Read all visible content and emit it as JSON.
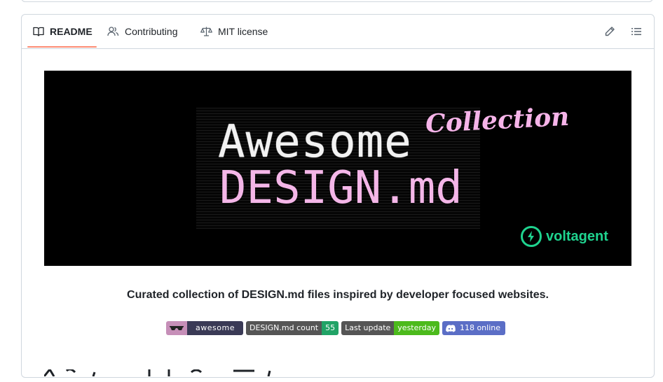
{
  "tabs": [
    {
      "label": "README",
      "icon": "book-icon",
      "active": true
    },
    {
      "label": "Contributing",
      "icon": "people-icon",
      "active": false
    },
    {
      "label": "MIT license",
      "icon": "law-icon",
      "active": false
    }
  ],
  "toolbar": {
    "edit_icon": "pencil-icon",
    "outline_icon": "list-icon"
  },
  "banner": {
    "line1": "Awesome",
    "line2": "DESIGN.md",
    "script": "Collection",
    "brand": "voltagent"
  },
  "tagline": "Curated collection of DESIGN.md files inspired by developer focused websites.",
  "badges": {
    "awesome": {
      "right": "awesome",
      "left_color": "#c68fb8",
      "right_color": "#3a3a56"
    },
    "count": {
      "left": "DESIGN.md count",
      "right": "55",
      "left_color": "#555555",
      "right_color": "#21a366"
    },
    "update": {
      "left": "Last update",
      "right": "yesterday",
      "left_color": "#555555",
      "right_color": "#4cba1c"
    },
    "discord": {
      "right": "118 online",
      "color": "#5b6ec6"
    }
  },
  "colors": {
    "accent_underline": "#fd8c73",
    "brand_green": "#1fd38f",
    "pink": "#f4b6e8"
  }
}
